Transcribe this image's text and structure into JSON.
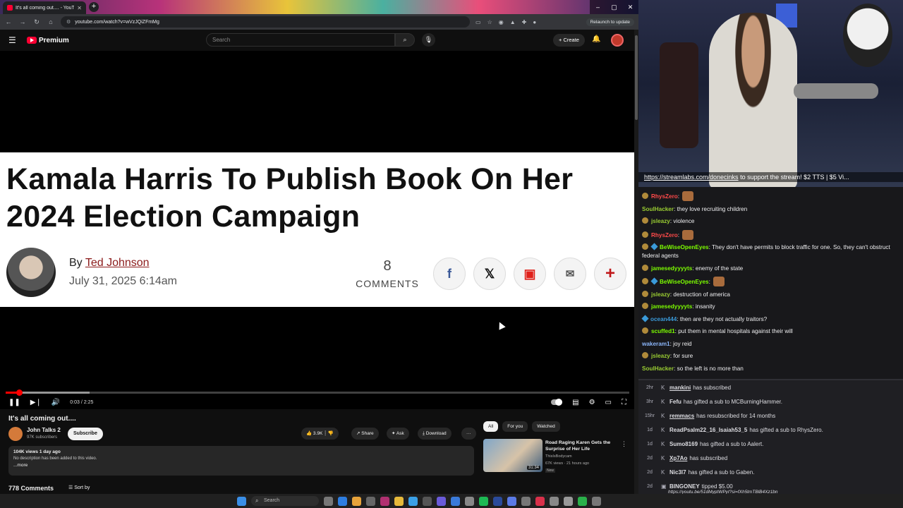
{
  "browser": {
    "tab_title": "It's all coming out.... - YouT",
    "tab_close": "✕",
    "new_tab": "+",
    "url": "youtube.com/watch?v=wVzJQiZFmMg",
    "relaunch": "Relaunch to update",
    "window_controls": [
      "–",
      "▢",
      "✕"
    ]
  },
  "youtube": {
    "logo_text": "Premium",
    "search_placeholder": "Search",
    "create_label": "+ Create",
    "video": {
      "headline": "Kamala Harris To Publish Book On Her 2024 Election Campaign",
      "by_prefix": "By ",
      "author": "Ted Johnson",
      "date": "July 31, 2025 6:14am",
      "comments_count": "8",
      "comments_label": "COMMENTS",
      "time_display": "0:03 / 2:25",
      "progress_fraction": 0.021,
      "buffer_fraction": 0.135
    },
    "title": "It's all coming out....",
    "channel": {
      "name": "John Talks 2",
      "subs": "97K subscribers"
    },
    "subscribe_label": "Subscribe",
    "actions": {
      "likes": "3.9K",
      "share": "Share",
      "ask": "Ask",
      "download": "Download",
      "more": "···"
    },
    "description": {
      "meta": "104K views  1 day ago",
      "text": "No description has been added to this video.",
      "more": "...more"
    },
    "comments_count": "778 Comments",
    "sort_by": "Sort by",
    "chips": [
      "All",
      "For you",
      "Watched"
    ],
    "recommendation": {
      "title": "Road Raging Karen Gets the Surprise of Her Life",
      "channel": "ThisIsBodycam",
      "views": "67K views · 21 hours ago",
      "badge": "New",
      "duration": "31:34"
    }
  },
  "stream": {
    "ticker_link": "https://streamlabs.com/donecinks",
    "ticker_text": " to support the stream! $2 TTS | $5 Vi..."
  },
  "chat": [
    {
      "user": "RhysZero",
      "color": "#ff4a4a",
      "text": "",
      "emote": true,
      "badge": "bdg"
    },
    {
      "user": "SoulHacker",
      "color": "#9acd32",
      "text": "they love recruiting children",
      "badge": ""
    },
    {
      "user": "jsleazy",
      "color": "#9acd32",
      "text": "violence",
      "badge": "bdg"
    },
    {
      "user": "RhysZero",
      "color": "#ff4a4a",
      "text": "",
      "emote": true,
      "badge": "bdg"
    },
    {
      "user": "BeWiseOpenEyes",
      "color": "#7cfc00",
      "text": "They don't have permits to block traffic for one. So, they can't obstruct federal agents",
      "badge": "bdg bdg2"
    },
    {
      "user": "jamesedyyyyts",
      "color": "#7cfc00",
      "text": "enemy of the state",
      "badge": "bdg"
    },
    {
      "user": "BeWiseOpenEyes",
      "color": "#7cfc00",
      "text": "",
      "emote": true,
      "badge": "bdg bdg2"
    },
    {
      "user": "jsleazy",
      "color": "#9acd32",
      "text": "destruction of america",
      "badge": "bdg"
    },
    {
      "user": "jamesedyyyyts",
      "color": "#7cfc00",
      "text": "insanity",
      "badge": "bdg"
    },
    {
      "user": "ocean444",
      "color": "#3a9ad9",
      "text": "then are they not actually traitors?",
      "badge": "bdg2"
    },
    {
      "user": "scuffed1",
      "color": "#7cfc00",
      "text": "put them in mental hospitals against their will",
      "badge": "bdg"
    },
    {
      "user": "wakeram1",
      "color": "#8ab4f8",
      "text": "joy reid",
      "badge": ""
    },
    {
      "user": "jsleazy",
      "color": "#9acd32",
      "text": "for sure",
      "badge": "bdg"
    },
    {
      "user": "SoulHacker",
      "color": "#9acd32",
      "text": "so the left is no more than",
      "badge": ""
    }
  ],
  "events": [
    {
      "age": "2hr",
      "name": "mankini",
      "underline": true,
      "text": "has subscribed"
    },
    {
      "age": "3hr",
      "name": "Fefu",
      "underline": false,
      "text": "has gifted a sub to MCBurningHammer."
    },
    {
      "age": "15hr",
      "name": "remmacs",
      "underline": true,
      "text": "has resubscribed for 14 months"
    },
    {
      "age": "1d",
      "name": "ReadPsalm22_16_Isaiah53_5",
      "underline": false,
      "text": "has gifted a sub to RhysZero."
    },
    {
      "age": "1d",
      "name": "Sumo8169",
      "underline": false,
      "text": "has gifted a sub to Aalert."
    },
    {
      "age": "2d",
      "name": "Xp7Ao",
      "underline": true,
      "text": "has subscribed"
    },
    {
      "age": "2d",
      "name": "Nic3l7",
      "underline": false,
      "text": "has gifted a sub to Gaben."
    },
    {
      "age": "2d",
      "name": "BINGONEY",
      "underline": false,
      "text": "tipped $5.00"
    }
  ],
  "tip_link": "https://youtu.be/51dMyptWPyI?si=fXh5tmTBlB4Xz1bn",
  "taskbar": {
    "search": "Search"
  }
}
